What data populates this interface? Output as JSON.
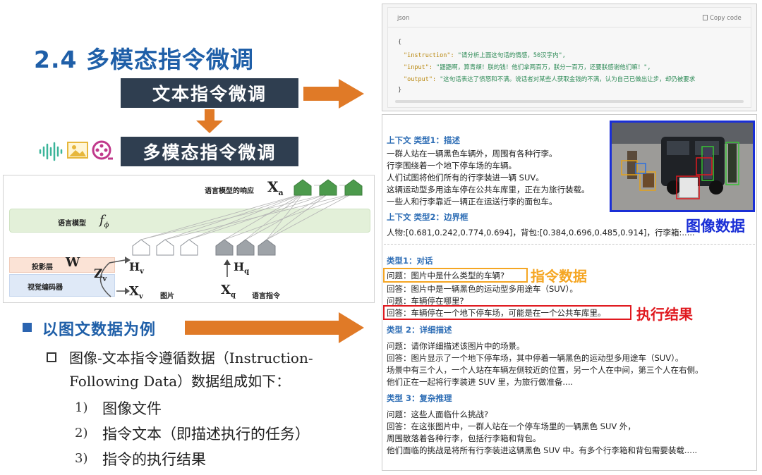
{
  "title": "2.4 多模态指令微调",
  "boxes": {
    "text_tuning": "文本指令微调",
    "mm_tuning": "多模态指令微调"
  },
  "icons": [
    "audio-waveform-icon",
    "image-icon",
    "film-reel-icon"
  ],
  "diagram": {
    "response_label": "语言模型的响应",
    "response_var": "X",
    "response_sub": "a",
    "lm_label": "语言模型",
    "lm_var": "f",
    "lm_sub": "ϕ",
    "proj_label": "投影层",
    "proj_var": "W",
    "encoder_label": "视觉编码器",
    "zv_var": "Z",
    "zv_sub": "v",
    "hv_var": "H",
    "hv_sub": "v",
    "hq_var": "H",
    "hq_sub": "q",
    "xv_var": "X",
    "xv_sub": "v",
    "xv_label": "图片",
    "xq_var": "X",
    "xq_sub": "q",
    "xq_label": "语言指令"
  },
  "bullet": {
    "heading": "以图文数据为例",
    "desc_line1": "图像-文本指令遵循数据（Instruction-",
    "desc_line2": "Following Data）数据组成如下：",
    "items": [
      {
        "num": "1)",
        "text": "图像文件"
      },
      {
        "num": "2)",
        "text": "指令文本（即描述执行的任务）"
      },
      {
        "num": "3)",
        "text": "指令的执行结果"
      }
    ]
  },
  "json_panel": {
    "lang": "json",
    "copy_label": "Copy code",
    "open_brace": "{",
    "close_brace": "}",
    "instruction_key": "\"instruction\":",
    "instruction_val": "\"请分析上面这句话的情感，50汉字内\",",
    "input_key": "\"input\":",
    "input_val": "\"鼯鼯啊，算青頫！朕的钱！他们拿两百万，朕分一百万，还要朕感谢他们嘛！\",",
    "output_key": "\"output\":",
    "output_val": "\"这句话表达了愤怒和不满。说话者对某些人获取金钱的不满，认为自己已做出让步，却仍被要求"
  },
  "data_panel": {
    "context1_head": "上下文 类型1：描述",
    "context1_lines": [
      "一群人站在一辆黑色车辆外，周围有各种行李。",
      "行李围绕着一个地下停车场的车辆。",
      "人们试图将他们所有的行李装进一辆 SUV。",
      "这辆运动型多用途车停在公共车库里，正在为旅行装载。",
      "一些人和行李靠近一辆正在运送行李的面包车。"
    ],
    "context2_head": "上下文 类型2：边界框",
    "context2_line": "人物:[0.681,0.242,0.774,0.694]，背包:[0.384,0.696,0.485,0.914]，行李箱:.....",
    "type1_head": "类型1：对话",
    "q1": "问题：图片中是什么类型的车辆?",
    "a1": "回答：图片中是一辆黑色的运动型多用途车（SUV）。",
    "q2": "问题：车辆停在哪里?",
    "a2": "回答：车辆停在一个地下停车场，可能是在一个公共车库里。",
    "type2_head": "类型 2：详细描述",
    "detail_lines": [
      "问题：请你详细描述该图片中的场景。",
      "回答：图片显示了一个地下停车场，其中停着一辆黑色的运动型多用途车（SUV）。",
      "场景中有三个人，一个人站在车辆左侧较近的位置，另一个人在中间，第三个人在右侧。",
      "他们正在一起将行李装进 SUV 里，为旅行做准备...."
    ],
    "type3_head": "类型 3：复杂推理",
    "reason_lines": [
      "问题：这些人面临什么挑战?",
      "回答：在这张图片中，一群人站在一个停车场里的一辆黑色 SUV 外，",
      "周围散落着各种行李，包括行李箱和背包。",
      "他们面临的挑战是将所有行李装进这辆黑色 SUV 中。有多个行李箱和背包需要装载....."
    ],
    "tag_image": "图像数据",
    "tag_instruction": "指令数据",
    "tag_result": "执行结果"
  },
  "colors": {
    "title_blue": "#1f5fa8",
    "dark_box": "#2f3e50",
    "arrow_orange": "#e07a27",
    "instruction_orange": "#f5a623",
    "result_red": "#e0191f",
    "image_blue": "#1a2fd6",
    "lm_band": "#e3f0d9",
    "proj_band": "#fbe3d6",
    "encoder_band": "#dfe9f7",
    "token_green": "#4c9a4c",
    "token_gray": "#9ea3a8"
  }
}
